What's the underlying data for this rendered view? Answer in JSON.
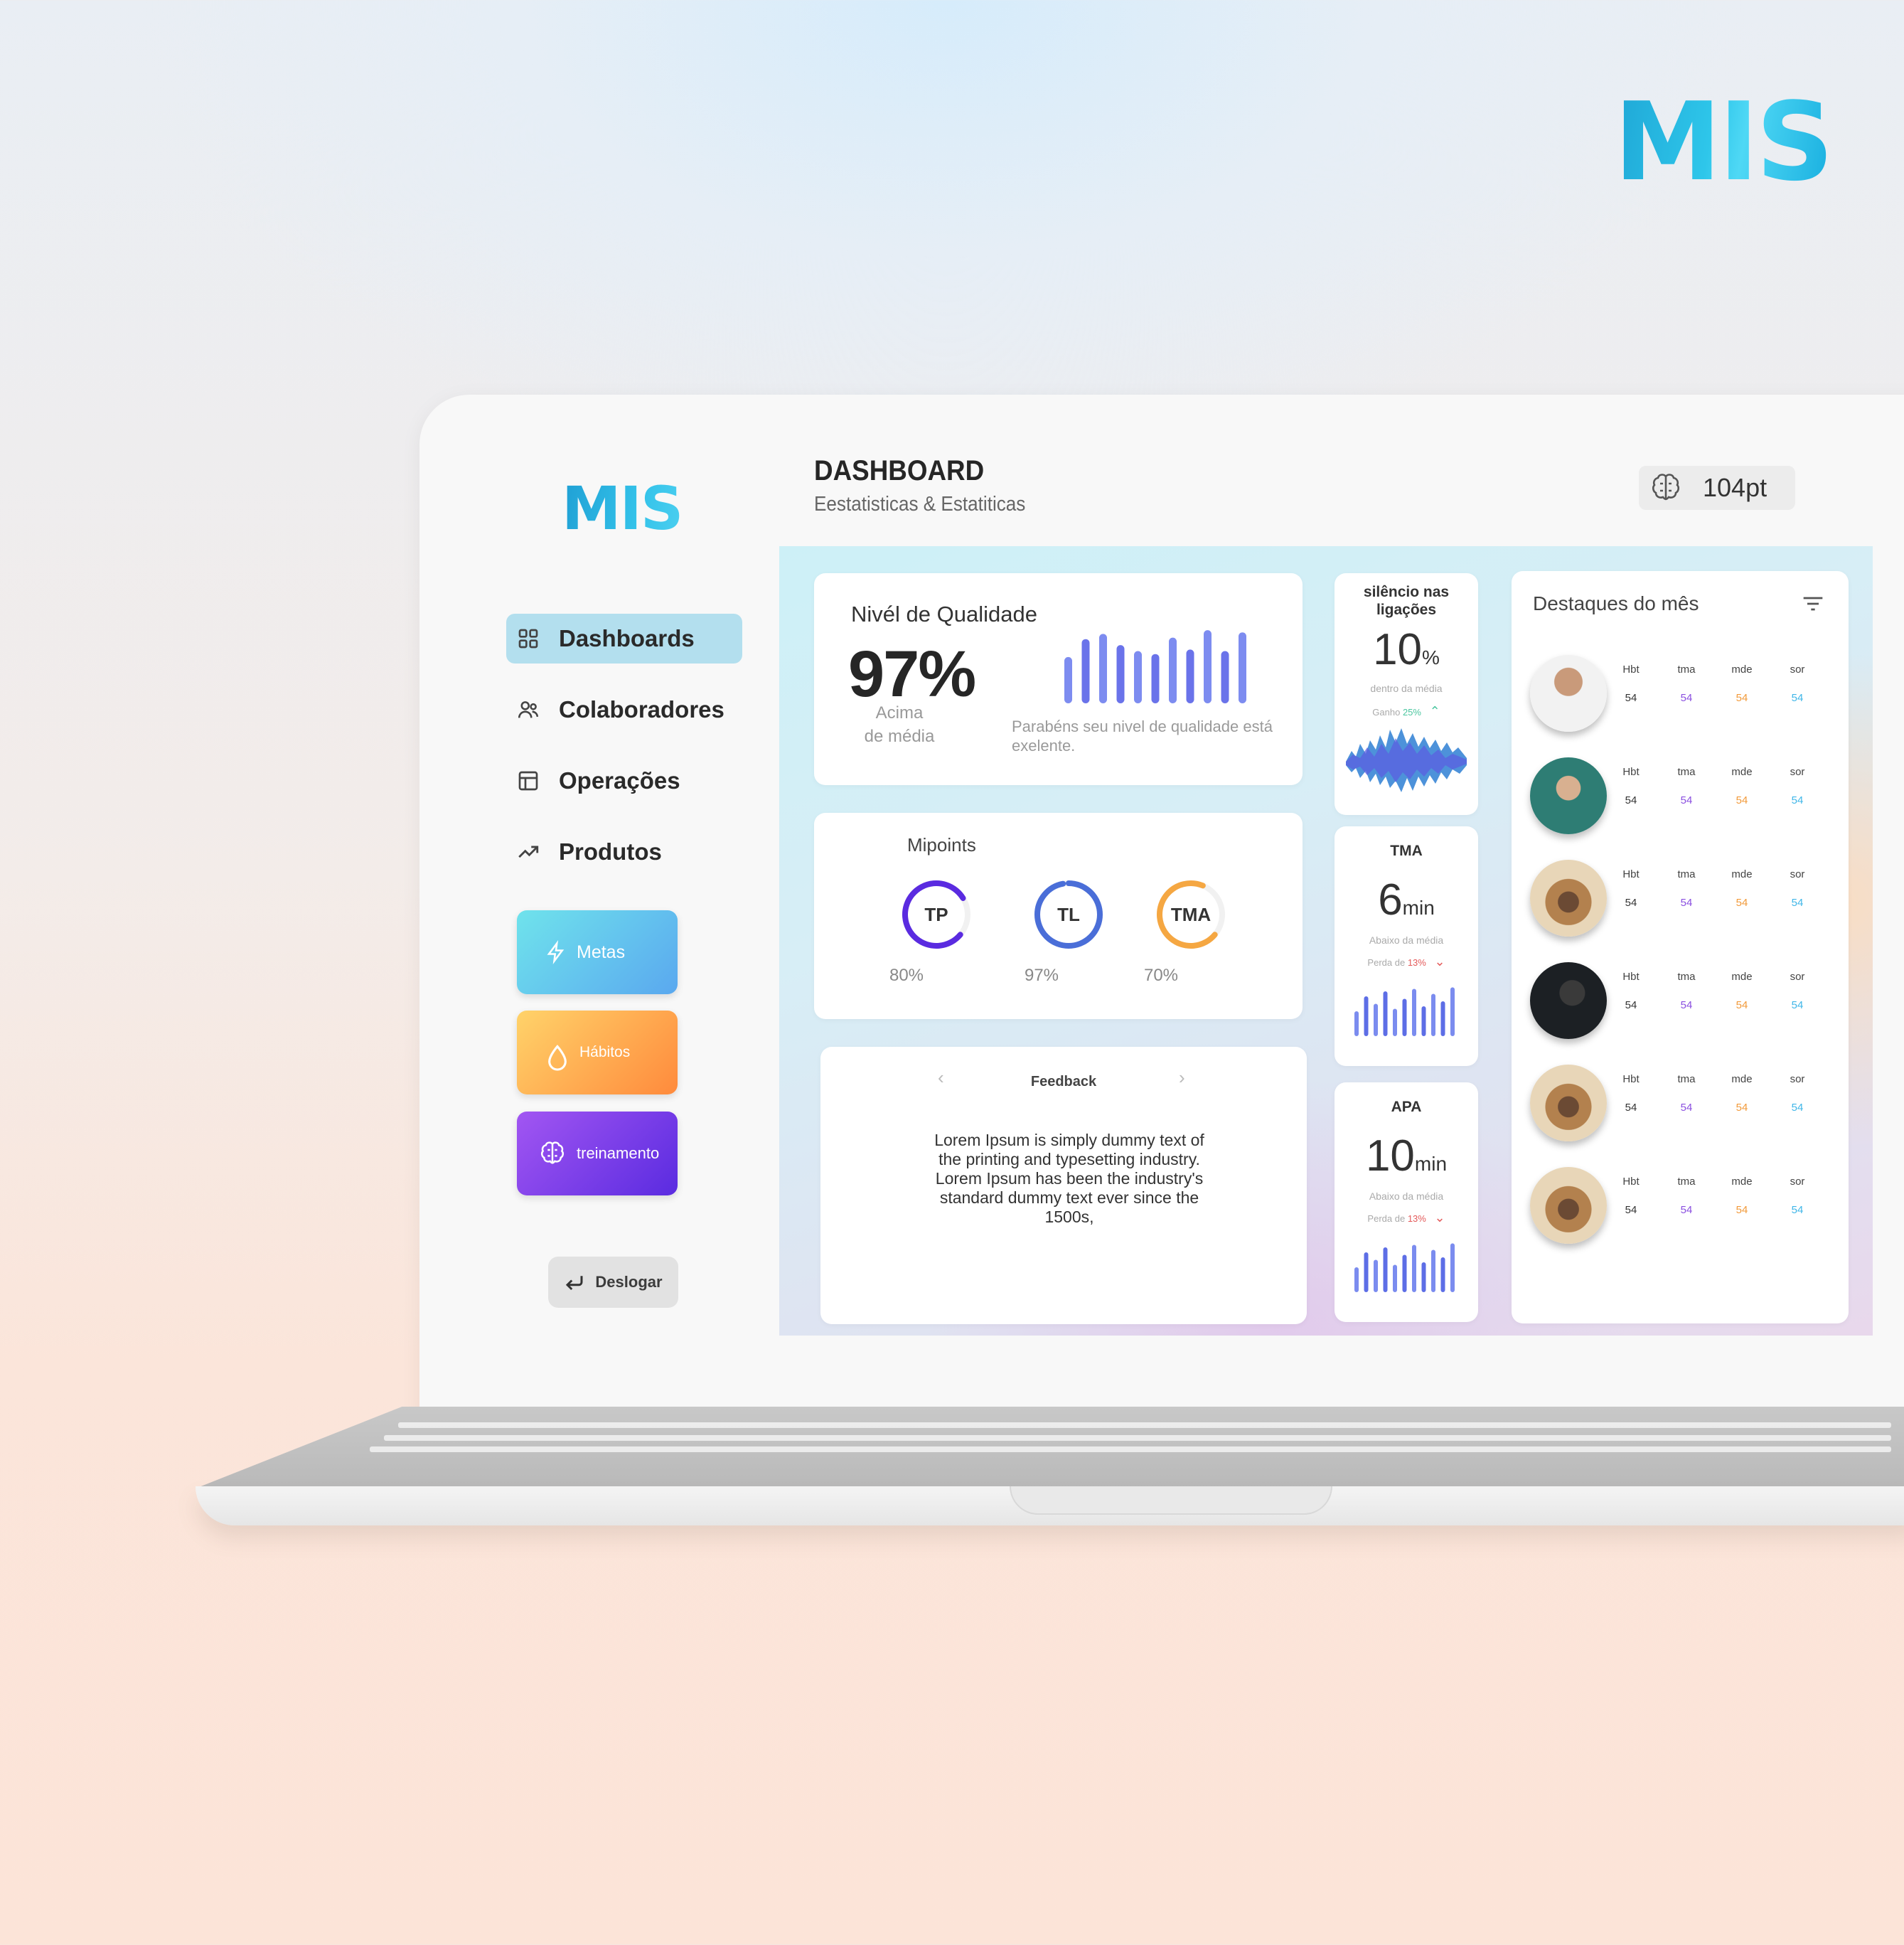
{
  "brand": "MIS",
  "sidebar": {
    "logo": "MIS",
    "nav": [
      {
        "label": "Dashboards",
        "icon": "grid-icon",
        "active": true
      },
      {
        "label": "Colaboradores",
        "icon": "users-icon",
        "active": false
      },
      {
        "label": "Operações",
        "icon": "layout-icon",
        "active": false
      },
      {
        "label": "Produtos",
        "icon": "trending-up-icon",
        "active": false
      }
    ],
    "tiles": [
      {
        "label": "Metas",
        "icon": "lightning-icon",
        "color": "#5aa8ef"
      },
      {
        "label": "Hábitos",
        "icon": "drop-icon",
        "color": "#ff8a3c"
      },
      {
        "label": "treinamento",
        "icon": "brain-icon",
        "color": "#6a35e6"
      }
    ],
    "logout": "Deslogar"
  },
  "header": {
    "title": "DASHBOARD",
    "subtitle": "Eestatisticas & Estatiticas",
    "points": "104pt",
    "points_icon": "brain-icon"
  },
  "quality": {
    "title": "Nivél de Qualidade",
    "value": "97%",
    "sub": "Acima de média",
    "message": "Parabéns seu nivel  de qualidade está exelente.",
    "bars": [
      0.62,
      0.86,
      0.93,
      0.78,
      0.7,
      0.66,
      0.88,
      0.72,
      0.98,
      0.7,
      0.95
    ]
  },
  "mipoints": {
    "title": "Mipoints",
    "rings": [
      {
        "label": "TP",
        "value": "80%",
        "fraction": 0.8,
        "color": "#5a2be0"
      },
      {
        "label": "TL",
        "value": "97%",
        "fraction": 0.97,
        "color": "#4a6ed8"
      },
      {
        "label": "TMA",
        "value": "70%",
        "fraction": 0.7,
        "color": "#f5a742"
      }
    ]
  },
  "feedback": {
    "title": "Feedback",
    "text": "Lorem Ipsum is simply dummy text of the printing and typesetting industry. Lorem Ipsum has been the industry's standard dummy text ever since the 1500s,"
  },
  "silence": {
    "title": "silêncio nas ligações",
    "value": "10",
    "unit": "%",
    "note": "dentro da média",
    "trend_label": "Ganho",
    "trend_value": "25%",
    "trend_color": "#4cc6a0"
  },
  "tma": {
    "title": "TMA",
    "value": "6",
    "unit": "min",
    "note": "Abaixo da média",
    "trend_label": "Perda de",
    "trend_value": "13%",
    "trend_color": "#e45a5a",
    "bars": [
      0.5,
      0.8,
      0.65,
      0.9,
      0.55,
      0.75,
      0.95,
      0.6,
      0.85,
      0.7,
      0.98
    ]
  },
  "apa": {
    "title": "APA",
    "value": "10",
    "unit": "min",
    "note": "Abaixo da média",
    "trend_label": "Perda de",
    "trend_value": "13%",
    "trend_color": "#e45a5a",
    "bars": [
      0.5,
      0.8,
      0.65,
      0.9,
      0.55,
      0.75,
      0.95,
      0.6,
      0.85,
      0.7,
      0.98
    ]
  },
  "highlights": {
    "title": "Destaques do mês",
    "columns": [
      "Hbt",
      "tma",
      "mde",
      "sor"
    ],
    "column_colors": [
      "#333333",
      "#8a4fe0",
      "#f29a3a",
      "#3fb6e8"
    ],
    "rows": [
      {
        "values": [
          "54",
          "54",
          "54",
          "54"
        ]
      },
      {
        "values": [
          "54",
          "54",
          "54",
          "54"
        ]
      },
      {
        "values": [
          "54",
          "54",
          "54",
          "54"
        ]
      },
      {
        "values": [
          "54",
          "54",
          "54",
          "54"
        ]
      },
      {
        "values": [
          "54",
          "54",
          "54",
          "54"
        ]
      },
      {
        "values": [
          "54",
          "54",
          "54",
          "54"
        ]
      }
    ]
  }
}
